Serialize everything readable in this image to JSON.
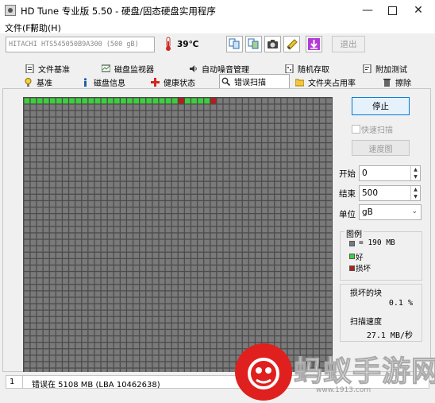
{
  "window": {
    "title": "HD Tune 专业版 5.50 - 硬盘/固态硬盘实用程序",
    "controls": [
      "minimize-icon",
      "maximize-icon",
      "close-icon"
    ]
  },
  "menu": {
    "file": "文件(F)",
    "help": "帮助(H)"
  },
  "toolbar": {
    "drive": "HITACHI HTS545050B9A300 (500 gB)",
    "temperature": "39℃",
    "icons": [
      "copy-info-icon",
      "copy-screen-icon",
      "camera-icon",
      "options-icon",
      "download-icon"
    ],
    "exit_label": "退出"
  },
  "tabs": {
    "row1": [
      "文件基准",
      "磁盘监视器",
      "自动噪音管理",
      "随机存取",
      "附加测试"
    ],
    "row2": [
      "基准",
      "磁盘信息",
      "健康状态",
      "错误扫描",
      "文件夹占用率",
      "擦除"
    ],
    "active": "错误扫描"
  },
  "scan": {
    "columns": 48,
    "rows": 43,
    "scanned_blocks": 30,
    "damaged_block_indices": [
      24,
      29
    ],
    "colors": {
      "unscanned": "#7a7a7a",
      "good": "#3fce3f",
      "damaged": "#b51d1d",
      "background": "#4c4c4c"
    }
  },
  "controls": {
    "stop_label": "停止",
    "quick_scan_label": "快速扫描",
    "speed_label": "速度图",
    "start_label": "开始",
    "start_value": "0",
    "end_label": "结束",
    "end_value": "500",
    "unit_label": "单位",
    "unit_value": "gB"
  },
  "legend": {
    "title": "图例",
    "block_size": "= 190 MB",
    "good": "好",
    "damaged": "损坏"
  },
  "stats": {
    "damaged_blocks_label": "损坏的块",
    "damaged_blocks_value": "0.1 %",
    "scan_speed_label": "扫描速度",
    "scan_speed_value": "27.1 MB/秒"
  },
  "status": {
    "count": "1",
    "message": "错误在 5108 MB (LBA 10462638)"
  },
  "watermark": {
    "text": "蚂蚁手游网",
    "url": "www.1913.com"
  }
}
